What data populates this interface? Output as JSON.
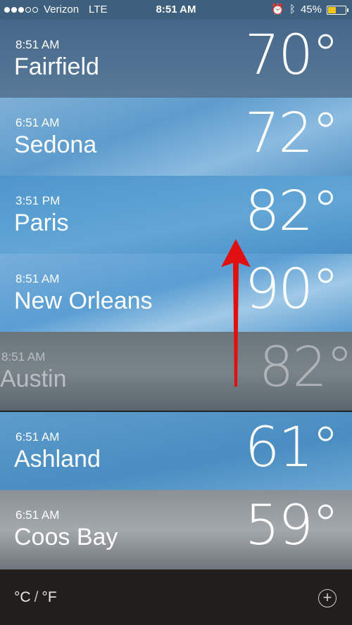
{
  "status_bar": {
    "carrier": "Verizon",
    "network": "LTE",
    "time": "8:51 AM",
    "battery_percent": "45%",
    "battery_level": 0.45
  },
  "cities": [
    {
      "time": "8:51 AM",
      "name": "Fairfield",
      "temp": "70°"
    },
    {
      "time": "6:51 AM",
      "name": "Sedona",
      "temp": "72°"
    },
    {
      "time": "3:51 PM",
      "name": "Paris",
      "temp": "82°"
    },
    {
      "time": "8:51 AM",
      "name": "New Orleans",
      "temp": "90°"
    },
    {
      "time": "8:51 AM",
      "name": "Austin",
      "temp": "82°"
    },
    {
      "time": "6:51 AM",
      "name": "Ashland",
      "temp": "61°"
    },
    {
      "time": "6:51 AM",
      "name": "Coos Bay",
      "temp": "59°"
    }
  ],
  "toolbar": {
    "celsius": "°C",
    "fahrenheit": "°F",
    "add_icon": "plus-circle-icon"
  },
  "annotation": {
    "arrow_color": "#e01010"
  }
}
